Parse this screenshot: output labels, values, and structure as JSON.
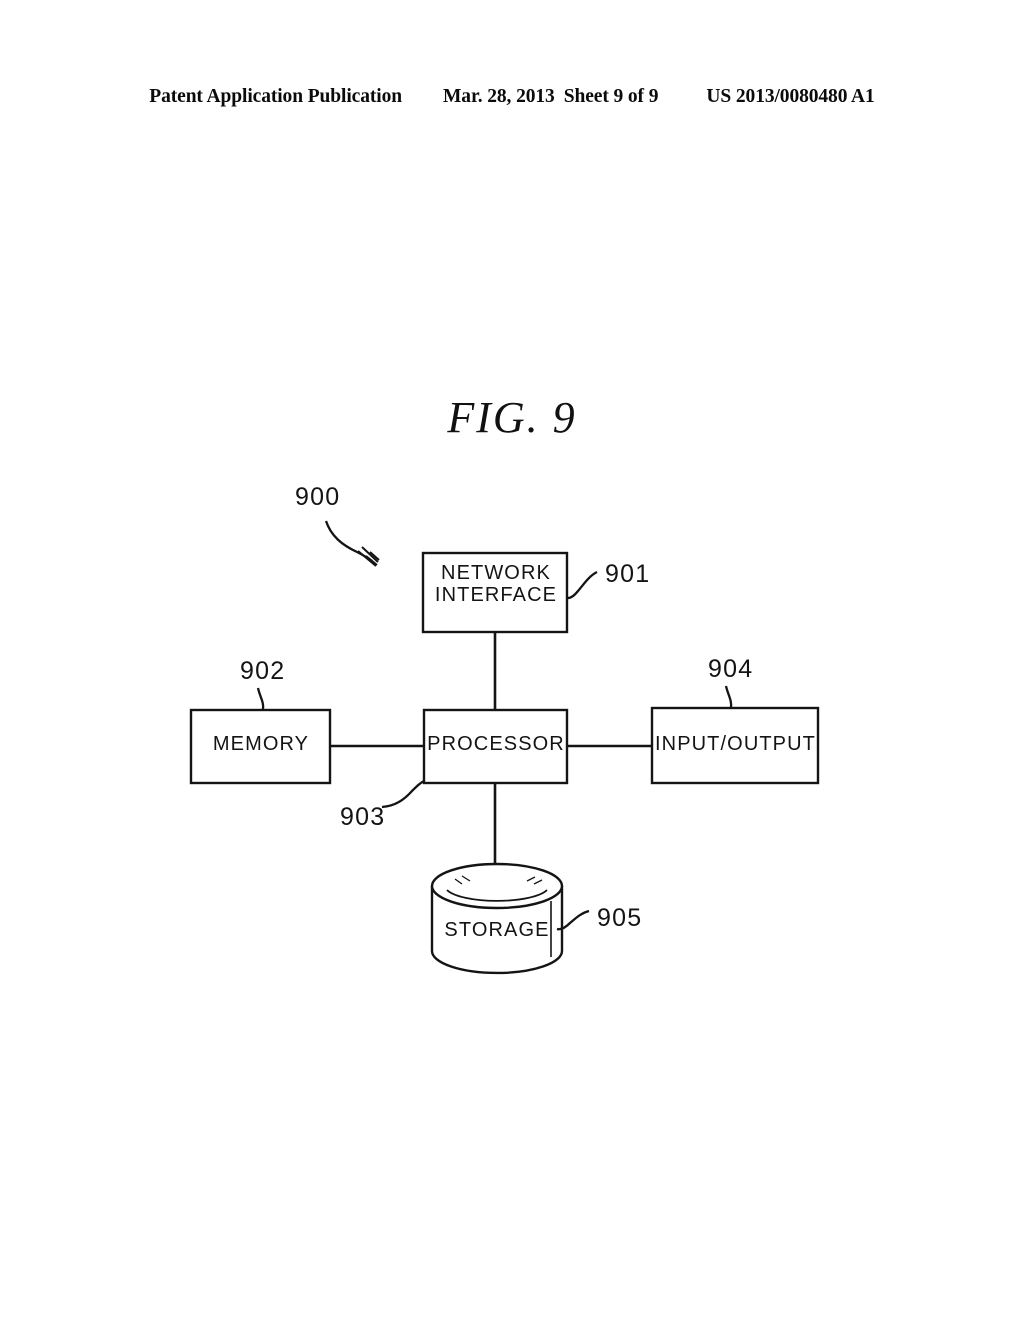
{
  "header": {
    "publication": "Patent Application Publication",
    "date": "Mar. 28, 2013",
    "sheet": "Sheet 9 of 9",
    "pub_number": "US 2013/0080480 A1"
  },
  "figure": {
    "title": "FIG.",
    "title_number": "9",
    "title_full": "FIG. 9",
    "system_ref": "900",
    "ink_color": "#141414",
    "background_color": "#ffffff"
  },
  "nodes": {
    "network_interface": {
      "line1": "NETWORK",
      "line2": "INTERFACE",
      "ref": "901",
      "shape": "rectangle"
    },
    "memory": {
      "label": "MEMORY",
      "ref": "902",
      "shape": "rectangle"
    },
    "processor": {
      "label": "PROCESSOR",
      "ref": "903",
      "shape": "rectangle"
    },
    "input_output": {
      "label": "INPUT/OUTPUT",
      "ref": "904",
      "shape": "rectangle"
    },
    "storage": {
      "label": "STORAGE",
      "ref": "905",
      "shape": "cylinder"
    }
  },
  "connections": [
    {
      "from": "network_interface",
      "to": "processor",
      "orientation": "vertical"
    },
    {
      "from": "memory",
      "to": "processor",
      "orientation": "horizontal"
    },
    {
      "from": "processor",
      "to": "input_output",
      "orientation": "horizontal"
    },
    {
      "from": "processor",
      "to": "storage",
      "orientation": "vertical"
    }
  ],
  "leader_lines": [
    {
      "ref": "900",
      "target": "system",
      "style": "curved-arrow"
    },
    {
      "ref": "901",
      "target": "network_interface",
      "style": "curved"
    },
    {
      "ref": "902",
      "target": "memory",
      "style": "curved"
    },
    {
      "ref": "903",
      "target": "processor",
      "style": "curved"
    },
    {
      "ref": "904",
      "target": "input_output",
      "style": "curved"
    },
    {
      "ref": "905",
      "target": "storage",
      "style": "curved"
    }
  ]
}
